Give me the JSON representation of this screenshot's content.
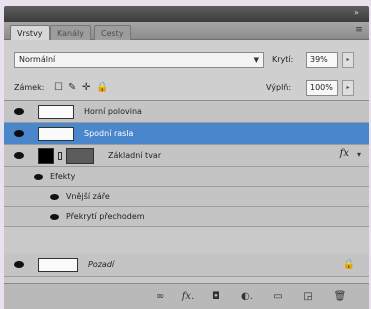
{
  "tabs": [
    {
      "label": "Vrstvy",
      "active": true
    },
    {
      "label": "Kanály",
      "active": false
    },
    {
      "label": "Cesty",
      "active": false
    }
  ],
  "panel_close_glyph": "»",
  "panel_menu_glyph": "≡",
  "blend_mode": "Normální",
  "opacity_label": "Krytí:",
  "opacity_value": "39%",
  "lock_label": "Zámek:",
  "fill_label": "Výplň:",
  "fill_value": "100%",
  "layers": [
    {
      "name": "Horní polovina",
      "selected": false,
      "thumb": "white"
    },
    {
      "name": "Spodní rasla",
      "selected": true,
      "thumb": "white"
    },
    {
      "name": "Základní tvar",
      "selected": false,
      "thumb": "black",
      "fx": "fx"
    },
    {
      "name": "Efekty",
      "selected": false,
      "sub": true,
      "level": 1
    },
    {
      "name": "Vnější záře",
      "selected": false,
      "sub": true,
      "level": 2
    },
    {
      "name": "Překrytí přechodem",
      "selected": false,
      "sub": true,
      "level": 2
    },
    {
      "name": "Pozadí",
      "selected": false,
      "thumb": "white",
      "locked": true
    }
  ],
  "fx_label": "fx",
  "icons": {
    "close": "double-chevron-right-icon",
    "menu": "panel-menu-icon",
    "eye": "eye-icon",
    "lock": "lock-icon",
    "link": "link-layers-icon",
    "fx": "layer-style-icon",
    "mask": "add-mask-icon",
    "adjust": "adjustment-layer-icon",
    "group": "new-group-icon",
    "new": "new-layer-icon",
    "trash": "trash-icon"
  },
  "toolbar_glyphs": {
    "link": "∞",
    "fx": "fx.",
    "mask": "◘",
    "adjust": "◐.",
    "group": "▭",
    "new": "◲",
    "trash": "🗑"
  },
  "lock_glyphs": [
    "☐",
    "✎",
    "✛",
    "🔒"
  ]
}
